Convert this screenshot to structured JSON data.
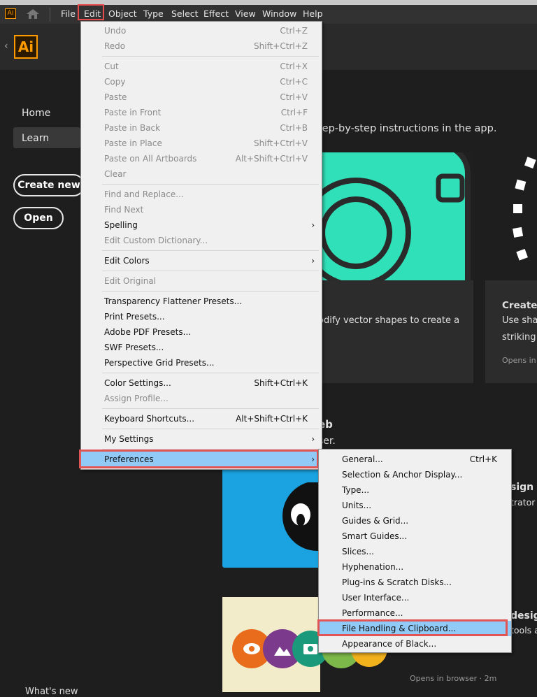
{
  "menubar": {
    "app_icon_text": "Ai",
    "items": [
      "File",
      "Edit",
      "Object",
      "Type",
      "Select",
      "Effect",
      "View",
      "Window",
      "Help"
    ]
  },
  "header": {
    "logo_text": "Ai"
  },
  "sidebar": {
    "nav": [
      "Home",
      "Learn"
    ],
    "create_new": "Create new",
    "open": "Open",
    "whats_new": "What's new"
  },
  "background": {
    "intro": "tep-by-step instructions in the app.",
    "card1_desc": "odify vector shapes to create a",
    "card2_title": "Create a",
    "card2_desc_1": "Use shap",
    "card2_desc_2": "striking n",
    "card2_footer": "Opens in a",
    "section_heading": "eb",
    "section_sub": "ser.",
    "card3_title": "sign p",
    "card3_desc": "trator t",
    "card4_title": "design",
    "card4_desc": "tools a",
    "footer": "Opens in browser · 2m"
  },
  "edit_menu": [
    {
      "label": "Undo",
      "shortcut": "Ctrl+Z",
      "disabled": true
    },
    {
      "label": "Redo",
      "shortcut": "Shift+Ctrl+Z",
      "disabled": true
    },
    {
      "label": "Cut",
      "shortcut": "Ctrl+X",
      "disabled": true
    },
    {
      "label": "Copy",
      "shortcut": "Ctrl+C",
      "disabled": true
    },
    {
      "label": "Paste",
      "shortcut": "Ctrl+V",
      "disabled": true
    },
    {
      "label": "Paste in Front",
      "shortcut": "Ctrl+F",
      "disabled": true
    },
    {
      "label": "Paste in Back",
      "shortcut": "Ctrl+B",
      "disabled": true
    },
    {
      "label": "Paste in Place",
      "shortcut": "Shift+Ctrl+V",
      "disabled": true
    },
    {
      "label": "Paste on All Artboards",
      "shortcut": "Alt+Shift+Ctrl+V",
      "disabled": true
    },
    {
      "label": "Clear",
      "shortcut": "",
      "disabled": true
    },
    {
      "label": "Find and Replace...",
      "shortcut": "",
      "disabled": true
    },
    {
      "label": "Find Next",
      "shortcut": "",
      "disabled": true
    },
    {
      "label": "Spelling",
      "shortcut": "",
      "disabled": false,
      "submenu": true
    },
    {
      "label": "Edit Custom Dictionary...",
      "shortcut": "",
      "disabled": true
    },
    {
      "label": "Edit Colors",
      "shortcut": "",
      "disabled": false,
      "submenu": true
    },
    {
      "label": "Edit Original",
      "shortcut": "",
      "disabled": true
    },
    {
      "label": "Transparency Flattener Presets...",
      "shortcut": "",
      "disabled": false
    },
    {
      "label": "Print Presets...",
      "shortcut": "",
      "disabled": false
    },
    {
      "label": "Adobe PDF Presets...",
      "shortcut": "",
      "disabled": false
    },
    {
      "label": "SWF Presets...",
      "shortcut": "",
      "disabled": false
    },
    {
      "label": "Perspective Grid Presets...",
      "shortcut": "",
      "disabled": false
    },
    {
      "label": "Color Settings...",
      "shortcut": "Shift+Ctrl+K",
      "disabled": false
    },
    {
      "label": "Assign Profile...",
      "shortcut": "",
      "disabled": true
    },
    {
      "label": "Keyboard Shortcuts...",
      "shortcut": "Alt+Shift+Ctrl+K",
      "disabled": false
    },
    {
      "label": "My Settings",
      "shortcut": "",
      "disabled": false,
      "submenu": true
    },
    {
      "label": "Preferences",
      "shortcut": "",
      "disabled": false,
      "submenu": true,
      "highlighted": true
    }
  ],
  "preferences_menu": [
    {
      "label": "General...",
      "shortcut": "Ctrl+K"
    },
    {
      "label": "Selection & Anchor Display...",
      "shortcut": ""
    },
    {
      "label": "Type...",
      "shortcut": ""
    },
    {
      "label": "Units...",
      "shortcut": ""
    },
    {
      "label": "Guides & Grid...",
      "shortcut": ""
    },
    {
      "label": "Smart Guides...",
      "shortcut": ""
    },
    {
      "label": "Slices...",
      "shortcut": ""
    },
    {
      "label": "Hyphenation...",
      "shortcut": ""
    },
    {
      "label": "Plug-ins & Scratch Disks...",
      "shortcut": ""
    },
    {
      "label": "User Interface...",
      "shortcut": ""
    },
    {
      "label": "Performance...",
      "shortcut": ""
    },
    {
      "label": "File Handling & Clipboard...",
      "shortcut": "",
      "highlighted": true
    },
    {
      "label": "Appearance of Black...",
      "shortcut": ""
    }
  ],
  "colors": {
    "accent_orange": "#ff9a00",
    "highlight_blue": "#91c9f7",
    "annotation_red": "#e25555"
  }
}
